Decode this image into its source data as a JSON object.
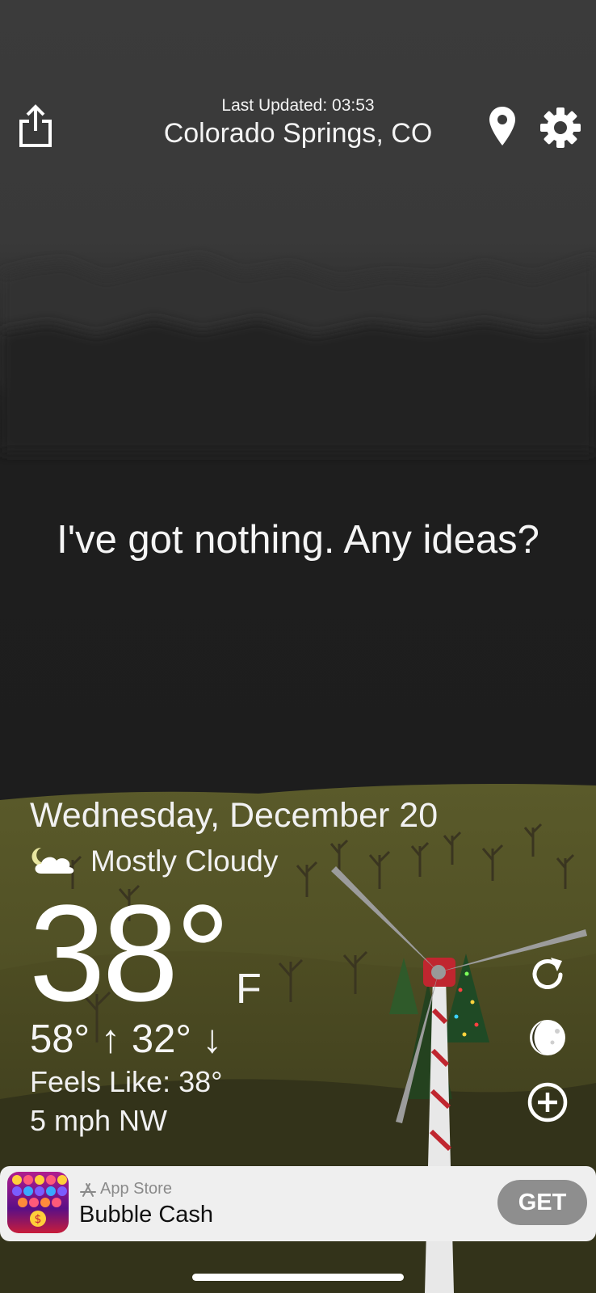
{
  "header": {
    "last_updated": "Last Updated: 03:53",
    "location": "Colorado Springs, CO",
    "share_icon": "share-icon",
    "location_icon": "map-pin-icon",
    "settings_icon": "gear-icon"
  },
  "snark_text": "I've got nothing. Any ideas?",
  "weather": {
    "date": "Wednesday, December 20",
    "condition_icon": "partly-cloudy-night-icon",
    "condition": "Mostly Cloudy",
    "temperature": "38°",
    "unit": "F",
    "high": "58°",
    "high_arrow": "↑",
    "low": "32°",
    "low_arrow": "↓",
    "feels_like": "Feels Like: 38°",
    "wind": "5 mph NW"
  },
  "side_buttons": {
    "refresh_icon": "refresh-icon",
    "moon_icon": "moon-phase-icon",
    "add_icon": "add-circle-icon"
  },
  "ad": {
    "store_label": "App Store",
    "app_name": "Bubble Cash",
    "cta": "GET"
  },
  "colors": {
    "sky_top": "#3b3b3b",
    "sky_bottom": "#1d1d1d",
    "ground": "#4d4b22",
    "ad_background": "#efefef",
    "get_button": "#8e8e8e"
  }
}
